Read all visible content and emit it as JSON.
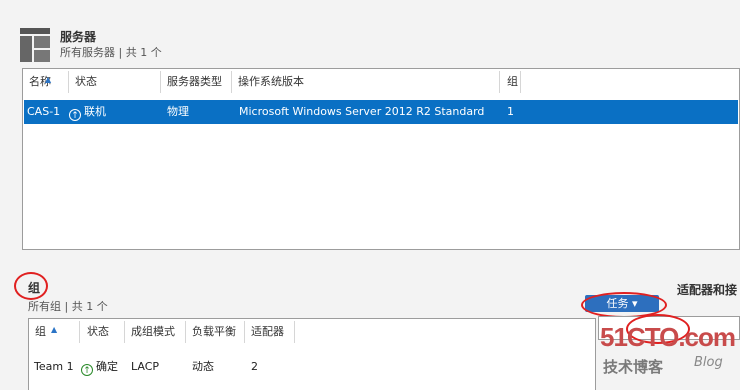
{
  "servers": {
    "title": "服务器",
    "subtitle": "所有服务器 | 共 1 个",
    "columns": [
      "名称",
      "状态",
      "服务器类型",
      "操作系统版本",
      "组"
    ],
    "rows": [
      {
        "name": "CAS-1",
        "status": "联机",
        "type": "物理",
        "os": "Microsoft Windows Server 2012 R2 Standard",
        "group": "1"
      }
    ]
  },
  "groups": {
    "title": "组",
    "subtitle": "所有组 | 共 1 个",
    "task_button": "任务",
    "columns": [
      "组",
      "状态",
      "成组模式",
      "负载平衡",
      "适配器"
    ],
    "rows": [
      {
        "group": "Team 1",
        "status": "确定",
        "mode": "LACP",
        "balance": "动态",
        "adapters": "2"
      }
    ]
  },
  "adapters": {
    "title": "适配器和接"
  },
  "watermark": {
    "site": "51CTO.com",
    "tagline": "技术博客",
    "blog": "Blog"
  },
  "colors": {
    "selection": "#0a70c4",
    "annotation": "#e02020",
    "task_button": "#2d6fbe"
  }
}
